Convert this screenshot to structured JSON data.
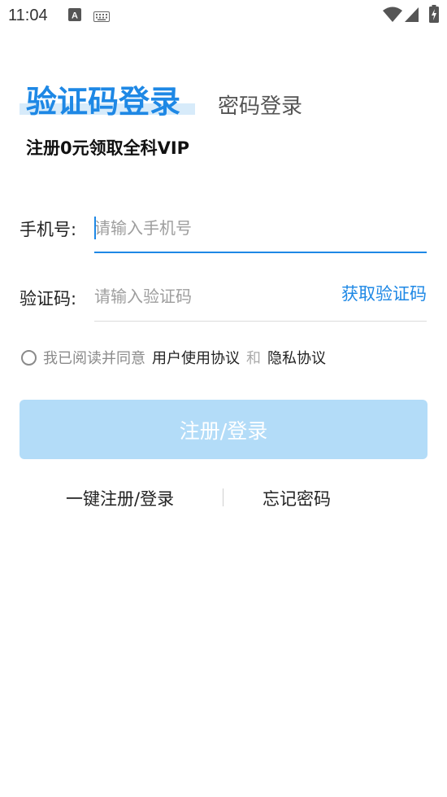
{
  "status_bar": {
    "time": "11:04",
    "icons": [
      "a-notification-icon",
      "keyboard-icon",
      "wifi-icon",
      "signal-icon",
      "battery-charging-icon"
    ]
  },
  "tabs": {
    "active": "验证码登录",
    "inactive": "密码登录"
  },
  "subtitle": "注册0元领取全科VIP",
  "phone": {
    "label": "手机号:",
    "placeholder": "请输入手机号",
    "value": ""
  },
  "code": {
    "label": "验证码:",
    "placeholder": "请输入验证码",
    "value": "",
    "get_code_label": "获取验证码"
  },
  "agreement": {
    "checked": false,
    "prefix": "我已阅读并同意",
    "user_agreement": "用户使用协议",
    "and": "和",
    "privacy": "隐私协议"
  },
  "submit_label": "注册/登录",
  "links": {
    "one_click": "一键注册/登录",
    "forgot": "忘记密码"
  },
  "colors": {
    "accent": "#1e88e5",
    "button_disabled": "#b3dcf8",
    "tab_highlight": "#d7ebfa"
  }
}
